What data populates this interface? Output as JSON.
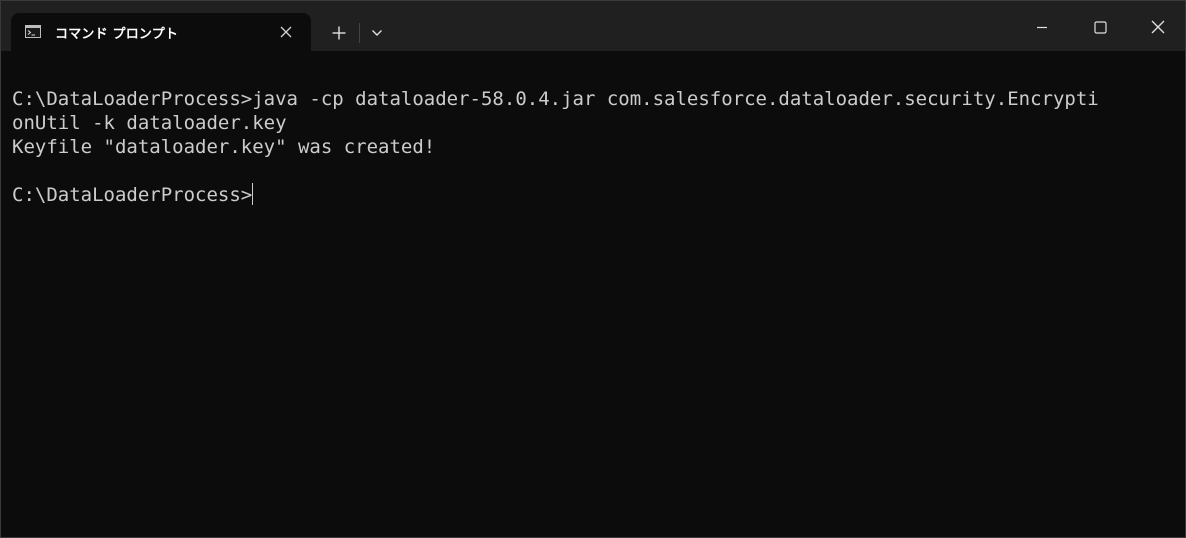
{
  "window": {
    "tab_title": "コマンド プロンプト"
  },
  "terminal": {
    "lines": [
      "C:\\DataLoaderProcess>java -cp dataloader-58.0.4.jar com.salesforce.dataloader.security.Encrypti",
      "onUtil -k dataloader.key",
      "Keyfile \"dataloader.key\" was created!",
      "",
      "C:\\DataLoaderProcess>"
    ]
  },
  "icons": {
    "tab_icon": "command-prompt-icon",
    "tab_close": "close-icon",
    "new_tab": "plus-icon",
    "dropdown": "chevron-down-icon",
    "minimize": "minimize-icon",
    "maximize": "maximize-icon",
    "close": "close-icon"
  },
  "colors": {
    "background": "#0c0c0c",
    "titlebar": "#202020",
    "text": "#cccccc"
  }
}
